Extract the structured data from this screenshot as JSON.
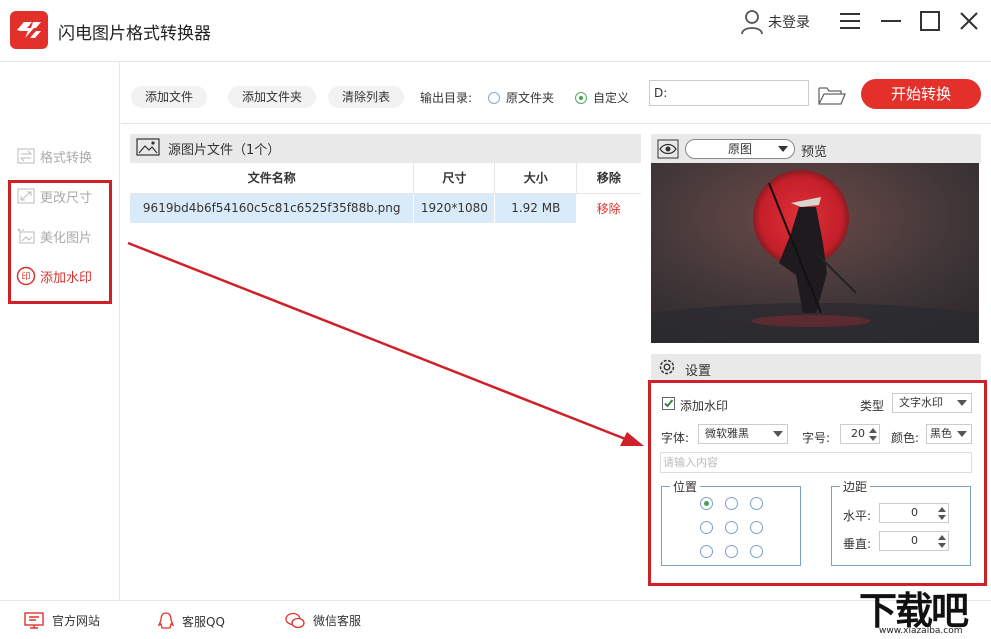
{
  "app": {
    "title": "闪电图片格式转换器",
    "user_label": "未登录"
  },
  "sidebar": {
    "items": [
      {
        "label": "格式转换",
        "icon": "swap-icon"
      },
      {
        "label": "更改尺寸",
        "icon": "resize-icon"
      },
      {
        "label": "美化图片",
        "icon": "beautify-icon"
      },
      {
        "label": "添加水印",
        "icon": "watermark-stamp-icon",
        "active": true
      }
    ]
  },
  "toolbar": {
    "add_file": "添加文件",
    "add_folder": "添加文件夹",
    "clear_list": "清除列表",
    "output_label": "输出目录:",
    "option_source": "原文件夹",
    "option_custom": "自定义",
    "selected_option": "自定义",
    "path_value": "D:",
    "start_button": "开始转换"
  },
  "file_list": {
    "header": "源图片文件（1个）",
    "columns": [
      "文件名称",
      "尺寸",
      "大小",
      "移除"
    ],
    "rows": [
      {
        "name": "9619bd4b6f54160c5c81c6525f35f88b.png",
        "size": "1920*1080",
        "filesize": "1.92 MB",
        "remove": "移除"
      }
    ]
  },
  "preview": {
    "mode": "原图",
    "label": "预览"
  },
  "settings": {
    "label": "设置",
    "add_watermark_label": "添加水印",
    "add_watermark_checked": true,
    "type_label": "类型",
    "type_value": "文字水印",
    "font_label": "字体:",
    "font_value": "微软雅黑",
    "font_size_label": "字号:",
    "font_size_value": "20",
    "color_label": "颜色:",
    "color_value": "黑色",
    "content_placeholder": "请输入内容",
    "position_label": "位置",
    "position_selected": "top-left",
    "margin_label": "边距",
    "horizontal_label": "水平:",
    "horizontal_value": "0",
    "vertical_label": "垂直:",
    "vertical_value": "0"
  },
  "footer": {
    "website": "官方网站",
    "qq": "客服QQ",
    "wechat": "微信客服"
  },
  "watermark_brand": {
    "title": "下载吧",
    "url": "www.xiazaiba.com"
  },
  "colors": {
    "accent": "#e3302b",
    "annotation": "#d0212a",
    "selected_row": "#d9ebf9"
  }
}
